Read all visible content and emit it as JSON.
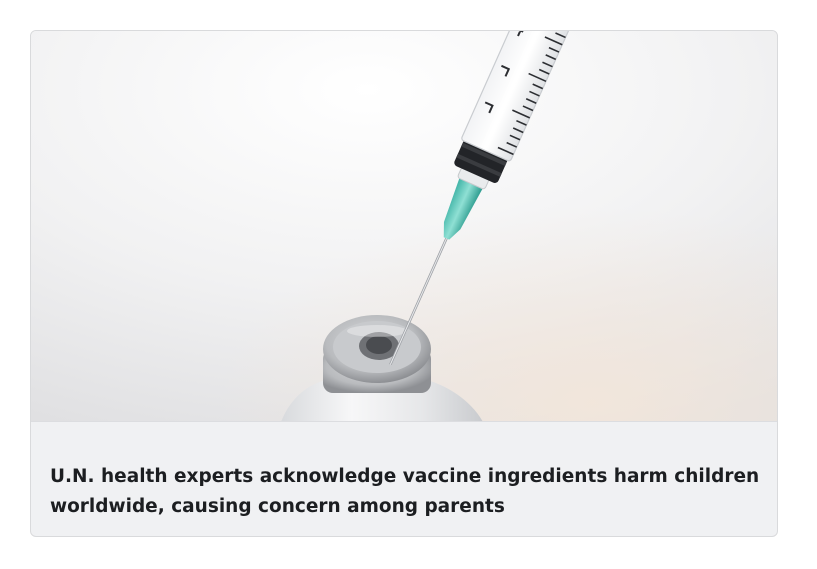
{
  "post": {
    "image_alt": "Syringe needle inserted into a vaccine vial",
    "headline": "U.N. health experts acknowledge vaccine ingredients harm children worldwide, causing concern among parents"
  }
}
